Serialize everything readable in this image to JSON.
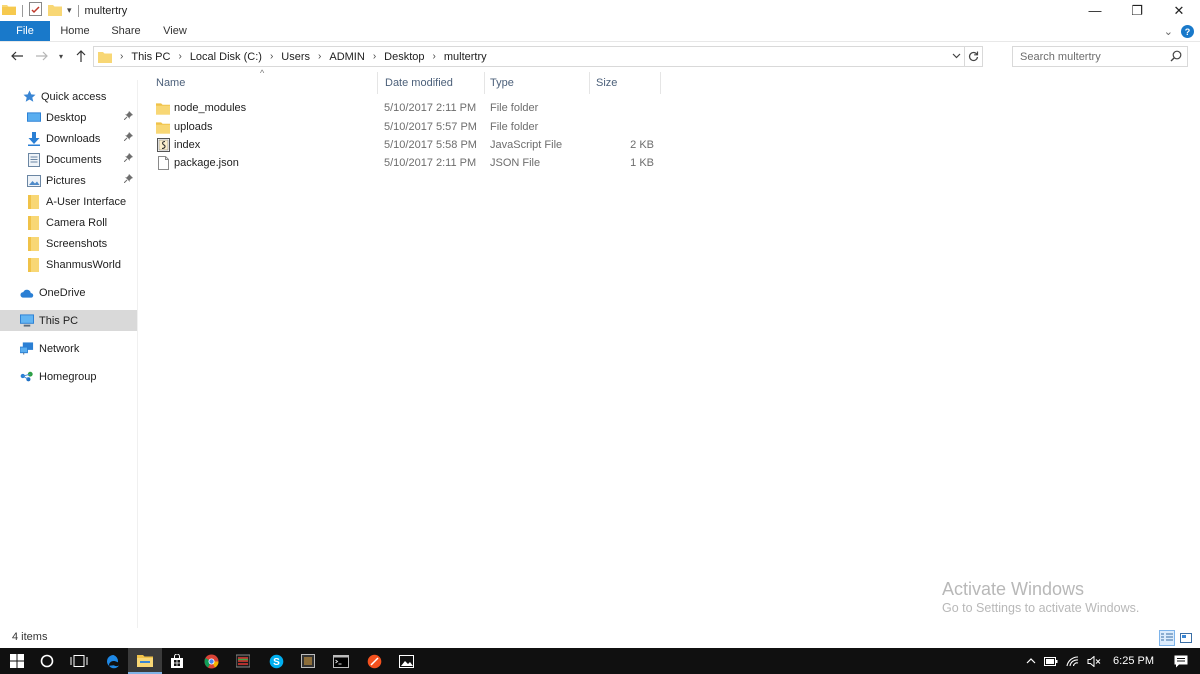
{
  "window": {
    "title": "multertry",
    "controls": {
      "minimize": "—",
      "maximize": "❐",
      "close": "✕"
    }
  },
  "ribbon": {
    "tabs": [
      "File",
      "Home",
      "Share",
      "View"
    ],
    "expand_glyph": "⌄",
    "help_glyph": "?"
  },
  "address": {
    "crumbs": [
      "This PC",
      "Local Disk (C:)",
      "Users",
      "ADMIN",
      "Desktop",
      "multertry"
    ],
    "search_placeholder": "Search multertry"
  },
  "nav": {
    "quick_access": "Quick access",
    "pinned": [
      {
        "label": "Desktop",
        "icon": "desktop-icon"
      },
      {
        "label": "Downloads",
        "icon": "downloads-icon"
      },
      {
        "label": "Documents",
        "icon": "documents-icon"
      },
      {
        "label": "Pictures",
        "icon": "pictures-icon"
      }
    ],
    "recent": [
      "A-User Interface",
      "Camera Roll",
      "Screenshots",
      "ShanmusWorld"
    ],
    "onedrive": "OneDrive",
    "this_pc": "This PC",
    "network": "Network",
    "homegroup": "Homegroup"
  },
  "columns": {
    "name": "Name",
    "date": "Date modified",
    "type": "Type",
    "size": "Size"
  },
  "files": [
    {
      "name": "node_modules",
      "date": "5/10/2017 2:11 PM",
      "type": "File folder",
      "size": "",
      "icon": "folder-icon"
    },
    {
      "name": "uploads",
      "date": "5/10/2017 5:57 PM",
      "type": "File folder",
      "size": "",
      "icon": "folder-icon"
    },
    {
      "name": "index",
      "date": "5/10/2017 5:58 PM",
      "type": "JavaScript File",
      "size": "2 KB",
      "icon": "javascript-file-icon"
    },
    {
      "name": "package.json",
      "date": "5/10/2017 2:11 PM",
      "type": "JSON File",
      "size": "1 KB",
      "icon": "file-icon"
    }
  ],
  "status": {
    "item_count": "4 items"
  },
  "watermark": {
    "title": "Activate Windows",
    "subtitle": "Go to Settings to activate Windows."
  },
  "taskbar": {
    "time": "6:25 PM"
  },
  "colors": {
    "accent": "#1979ca",
    "folder": "#f8d775",
    "selected": "#d9d9d9",
    "taskbar": "#101010"
  }
}
